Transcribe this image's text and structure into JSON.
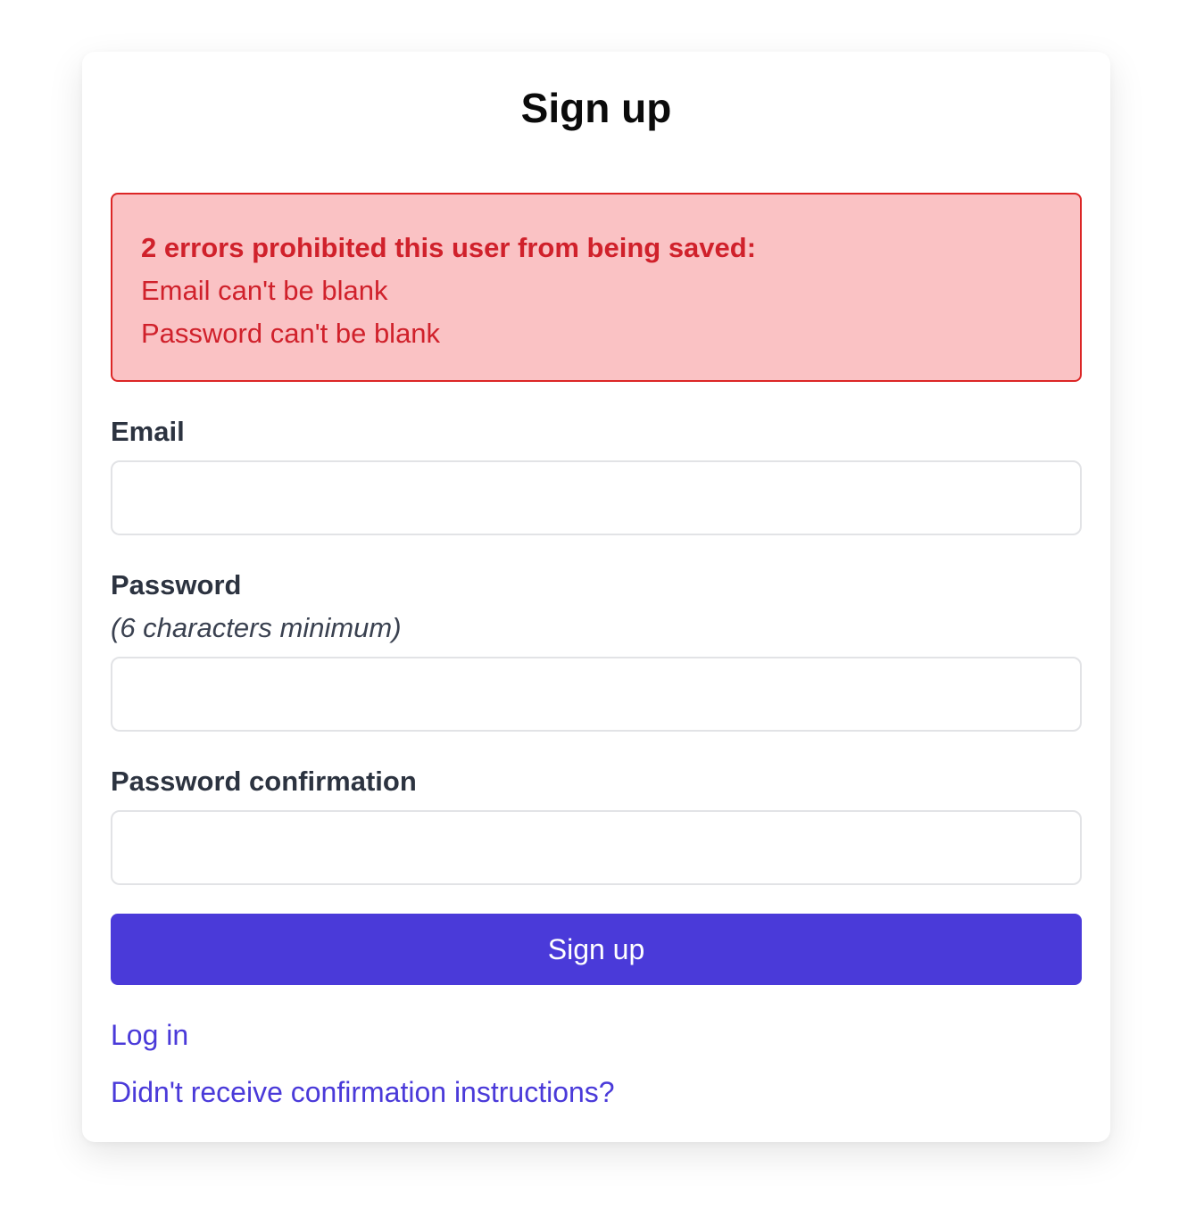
{
  "page": {
    "title": "Sign up"
  },
  "errors": {
    "heading": "2 errors prohibited this user from being saved:",
    "messages": [
      "Email can't be blank",
      "Password can't be blank"
    ]
  },
  "form": {
    "email_label": "Email",
    "email_value": "",
    "password_label": "Password",
    "password_hint": "(6 characters minimum)",
    "password_value": "",
    "password_confirmation_label": "Password confirmation",
    "password_confirmation_value": "",
    "submit_label": "Sign up"
  },
  "links": {
    "login": "Log in",
    "confirmation": "Didn't receive confirmation instructions?"
  },
  "colors": {
    "accent": "#4a3ad9",
    "error_text": "#d0212b",
    "error_bg": "#fac2c4",
    "error_border": "#dc2626"
  }
}
